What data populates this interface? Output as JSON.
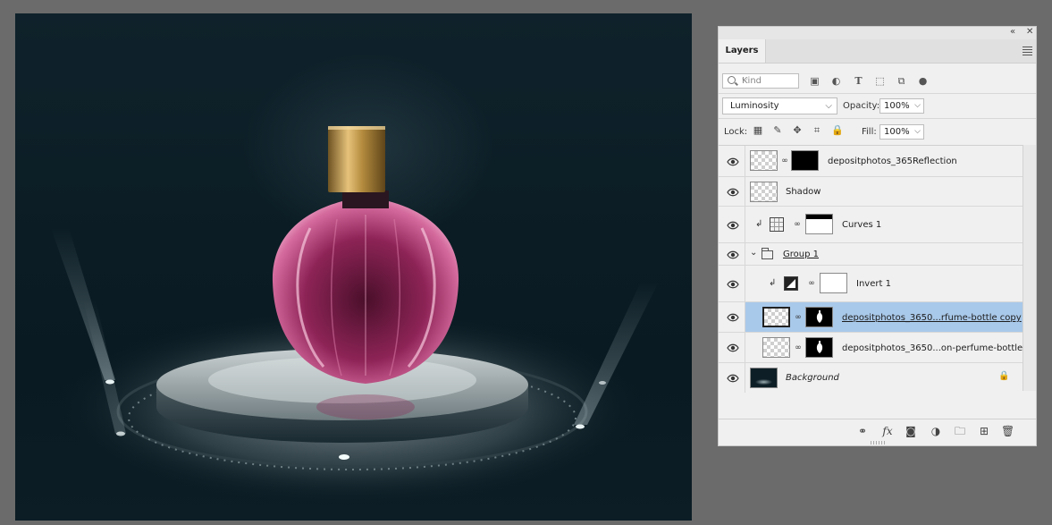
{
  "panel": {
    "title": "Layers",
    "collapse_glyph": "«",
    "close_glyph": "✕",
    "filter_kind_placeholder": "Kind",
    "blend_mode": "Luminosity",
    "opacity_label": "Opacity:",
    "opacity_value": "100%",
    "lock_label": "Lock:",
    "fill_label": "Fill:",
    "fill_value": "100%"
  },
  "layers": [
    {
      "name": "depositphotos_365Reflection",
      "visible": true,
      "type": "smart-object-with-mask"
    },
    {
      "name": "Shadow",
      "visible": true,
      "type": "pixel"
    },
    {
      "name": "Curves 1",
      "visible": true,
      "type": "adjustment-curves",
      "clipped": true
    },
    {
      "name": "Group 1",
      "visible": true,
      "type": "group",
      "expanded": true
    },
    {
      "name": "Invert 1",
      "visible": true,
      "type": "adjustment-invert",
      "clipped": true
    },
    {
      "name": "depositphotos_3650...rfume-bottle copy",
      "visible": true,
      "type": "smart-object-with-mask",
      "selected": true
    },
    {
      "name": "depositphotos_3650...on-perfume-bottle",
      "visible": true,
      "type": "smart-object-with-mask"
    },
    {
      "name": "Background",
      "visible": true,
      "type": "background",
      "locked": true
    }
  ],
  "icons": {
    "filter": [
      "image-filter-icon",
      "adjustment-filter-icon",
      "type-filter-icon",
      "shape-filter-icon",
      "smart-object-filter-icon",
      "filter-toggle-icon"
    ],
    "lock": [
      "lock-transparent-pixels-icon",
      "lock-image-pixels-icon",
      "lock-position-icon",
      "lock-artboard-icon",
      "lock-all-icon"
    ],
    "bottom": [
      "link-layers-icon",
      "fx-icon",
      "add-mask-icon",
      "new-adjustment-icon",
      "new-group-icon",
      "new-layer-icon",
      "delete-layer-icon"
    ]
  },
  "colors": {
    "selection": "#a9c9ea",
    "panel_bg": "#f0f0f0",
    "workspace_bg": "#6b6b6b",
    "bottle_pink": "#b0336e",
    "cap_gold": "#c9a255"
  }
}
